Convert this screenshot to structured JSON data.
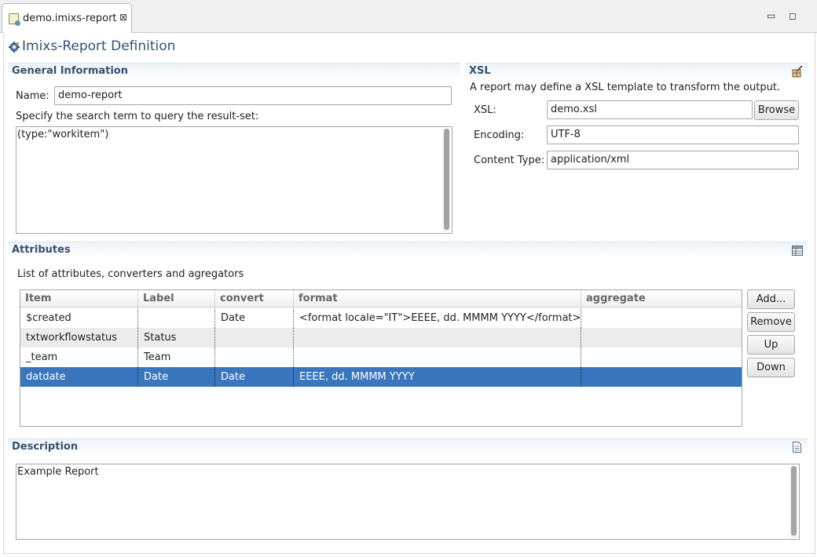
{
  "tab": {
    "title": "demo.imixs-report",
    "close": "⊠"
  },
  "window": {
    "minimize": "▭",
    "maximize": "◻"
  },
  "form": {
    "title": "Imixs-Report Definition"
  },
  "general": {
    "title": "General Information",
    "name_label": "Name:",
    "name_value": "demo-report",
    "query_label": "Specify the search term to query the result-set:",
    "query_value": "(type:\"workitem\")"
  },
  "xsl": {
    "title": "XSL",
    "description": "A report may define a XSL template to transform the output.",
    "xsl_label": "XSL:",
    "xsl_value": "demo.xsl",
    "browse_label": "Browse",
    "encoding_label": "Encoding:",
    "encoding_value": "UTF-8",
    "content_type_label": "Content Type:",
    "content_type_value": "application/xml"
  },
  "attributes": {
    "title": "Attributes",
    "description": "List of attributes, converters and agregators",
    "columns": [
      "Item",
      "Label",
      "convert",
      "format",
      "aggregate"
    ],
    "rows": [
      [
        "$created",
        "",
        "Date",
        "<format  locale=\"IT\">EEEE, dd. MMMM YYYY</format>",
        ""
      ],
      [
        "txtworkflowstatus",
        "Status",
        "",
        "",
        ""
      ],
      [
        "_team",
        "Team",
        "",
        "",
        ""
      ],
      [
        "datdate",
        "Date",
        "Date",
        "EEEE, dd. MMMM YYYY",
        ""
      ]
    ],
    "selected_row": 3,
    "buttons": {
      "add": "Add...",
      "remove": "Remove",
      "up": "Up",
      "down": "Down"
    }
  },
  "description": {
    "title": "Description",
    "value": "Example Report"
  },
  "colors": {
    "section_title": "#36506e",
    "selection": "#3a76bd"
  }
}
